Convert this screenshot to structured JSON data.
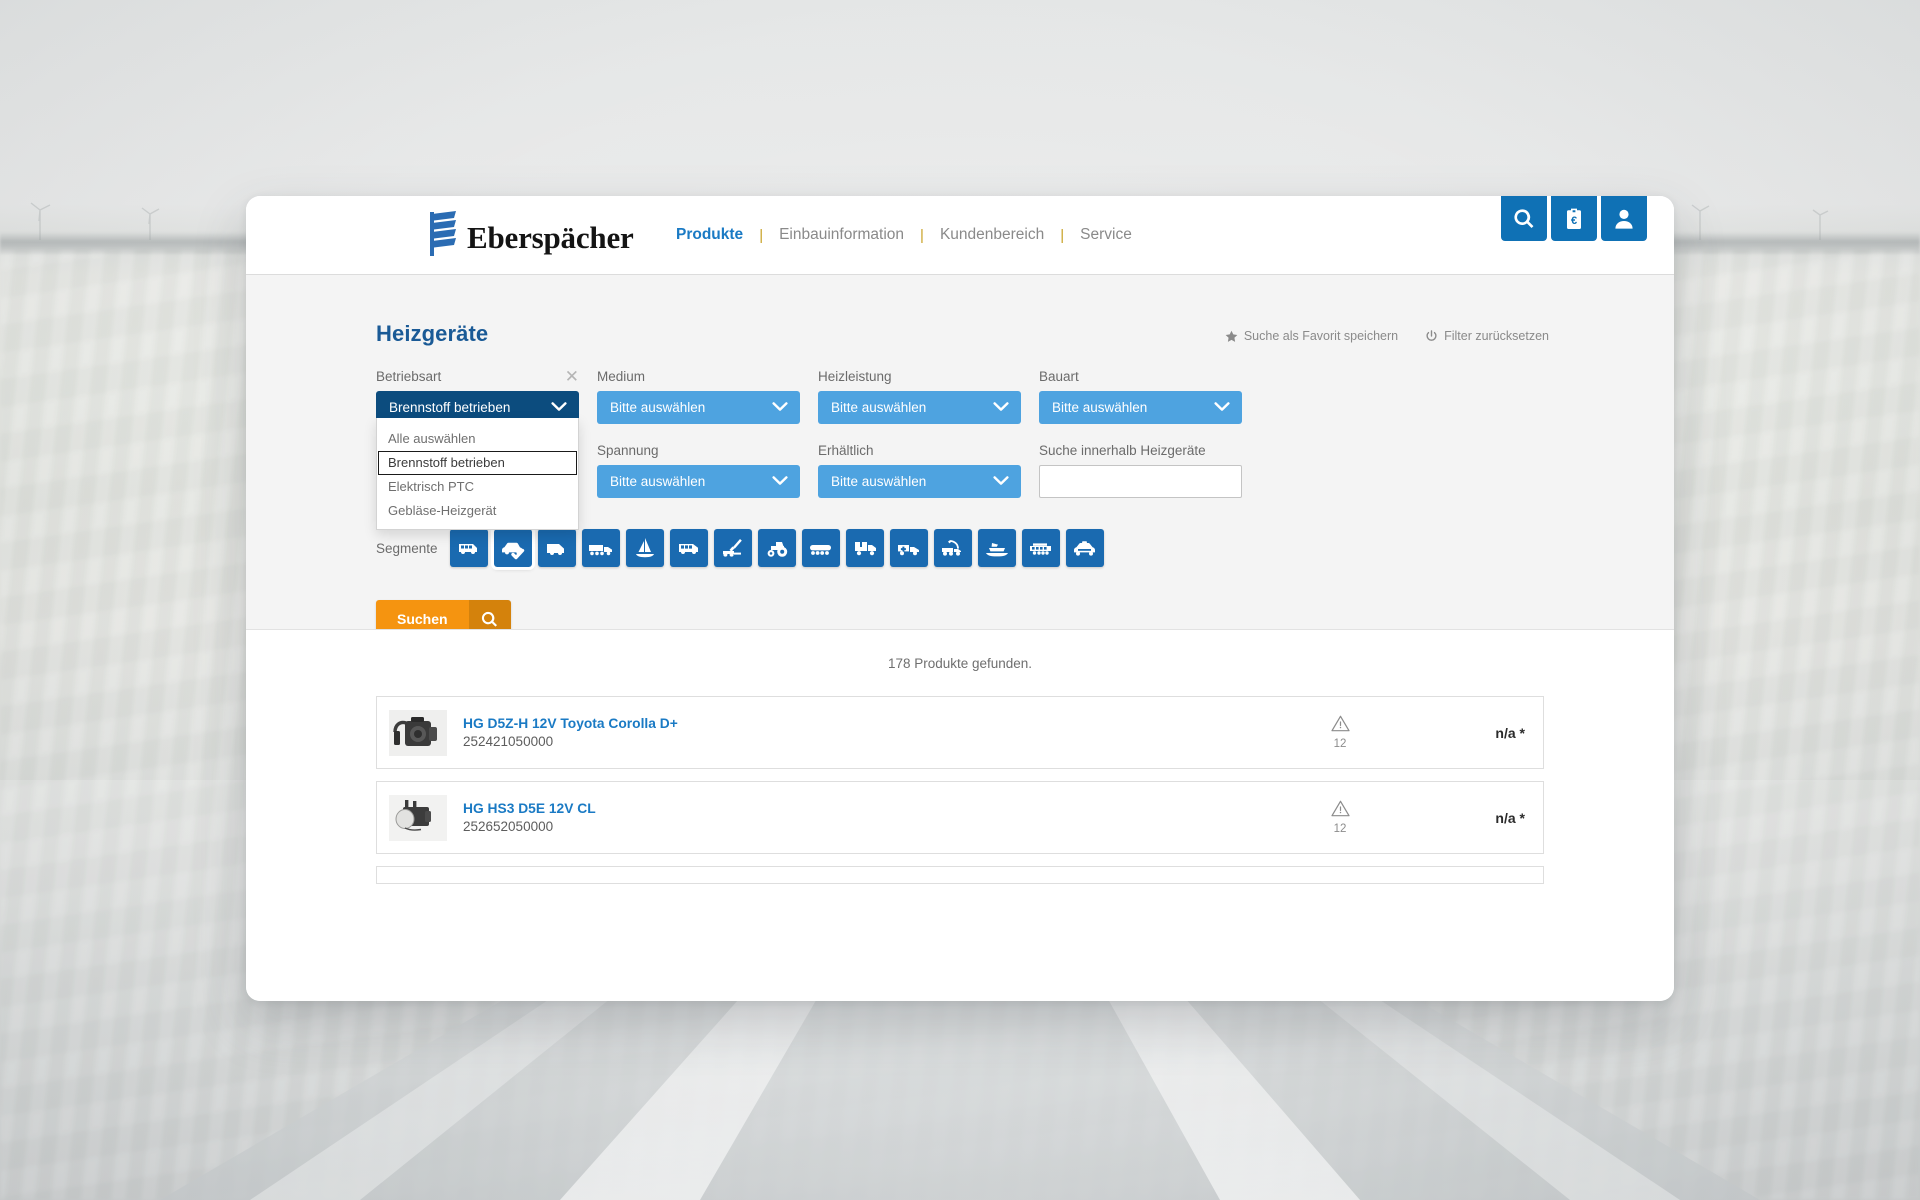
{
  "header": {
    "logo_text": "Eberspächer",
    "logo_icon": "eberspaecher-logo-icon",
    "nav": [
      {
        "label": "Produkte",
        "active": true
      },
      {
        "label": "Einbauinformation",
        "active": false
      },
      {
        "label": "Kundenbereich",
        "active": false
      },
      {
        "label": "Service",
        "active": false
      }
    ],
    "separator": "|",
    "icon_buttons": [
      {
        "name": "search-icon",
        "label": "Suche"
      },
      {
        "name": "clipboard-euro-icon",
        "label": "Warenkorb"
      },
      {
        "name": "user-icon",
        "label": "Benutzerkonto"
      }
    ]
  },
  "filter_panel": {
    "page_title": "Heizgeräte",
    "actions": [
      {
        "icon": "star-icon",
        "label": "Suche als Favorit speichern"
      },
      {
        "icon": "reset-power-icon",
        "label": "Filter zurücksetzen"
      }
    ],
    "fields_row1": [
      {
        "label": "Betriebsart",
        "value": "Brennstoff betrieben",
        "state": "open",
        "clearable": true,
        "clear_glyph": "✕"
      },
      {
        "label": "Medium",
        "value": "Bitte auswählen",
        "state": "closed",
        "clearable": false
      },
      {
        "label": "Heizleistung",
        "value": "Bitte auswählen",
        "state": "closed",
        "clearable": false
      },
      {
        "label": "Bauart",
        "value": "Bitte auswählen",
        "state": "closed",
        "clearable": false
      }
    ],
    "fields_row2": [
      {
        "label": "Spannung",
        "value": "Bitte auswählen",
        "state": "closed",
        "clearable": false
      },
      {
        "label": "Erhältlich",
        "value": "Bitte auswählen",
        "state": "closed",
        "clearable": false
      }
    ],
    "text_search": {
      "label": "Suche innerhalb Heizgeräte",
      "value": "",
      "placeholder": ""
    },
    "open_dropdown_options": [
      {
        "label": "Alle auswählen",
        "focused": false
      },
      {
        "label": "Brennstoff betrieben",
        "focused": true
      },
      {
        "label": "Elektrisch PTC",
        "focused": false
      },
      {
        "label": "Gebläse-Heizgerät",
        "focused": false
      }
    ],
    "segments": {
      "label": "Segmente",
      "items": [
        {
          "icon": "minibus-icon",
          "selected": false
        },
        {
          "icon": "passenger-car-icon",
          "selected": true
        },
        {
          "icon": "van-icon",
          "selected": false
        },
        {
          "icon": "semi-truck-icon",
          "selected": false
        },
        {
          "icon": "sailboat-icon",
          "selected": false
        },
        {
          "icon": "bus-icon",
          "selected": false
        },
        {
          "icon": "excavator-icon",
          "selected": false
        },
        {
          "icon": "tractor-icon",
          "selected": false
        },
        {
          "icon": "tanker-trailer-icon",
          "selected": false
        },
        {
          "icon": "box-truck-icon",
          "selected": false
        },
        {
          "icon": "ambulance-icon",
          "selected": false
        },
        {
          "icon": "tow-truck-icon",
          "selected": false
        },
        {
          "icon": "motor-yacht-icon",
          "selected": false
        },
        {
          "icon": "rail-car-icon",
          "selected": false
        },
        {
          "icon": "police-car-icon",
          "selected": false
        }
      ]
    },
    "search_button": {
      "label": "Suchen",
      "icon": "search-icon"
    }
  },
  "results": {
    "count_text": "178 Produkte gefunden.",
    "items": [
      {
        "title": "HG D5Z-H 12V Toyota Corolla D+",
        "sku": "252421050000",
        "warn_icon": "warning-triangle-icon",
        "warn_number": "12",
        "price": "n/a *",
        "thumb": "heater-unit-photo"
      },
      {
        "title": "HG HS3 D5E 12V CL",
        "sku": "252652050000",
        "warn_icon": "warning-triangle-icon",
        "warn_number": "12",
        "price": "n/a *",
        "thumb": "heater-unit-photo-2"
      }
    ]
  },
  "colors": {
    "brand_blue": "#0f71b5",
    "title_blue": "#1a5a96",
    "dropdown_blue": "#4ea3e0",
    "dropdown_open_blue": "#0c4c7e",
    "segment_blue": "#1a6ab0",
    "accent_orange": "#f59410",
    "accent_orange_dark": "#d4820c",
    "link_blue": "#1a7ac4",
    "panel_grey": "#f4f4f4"
  }
}
